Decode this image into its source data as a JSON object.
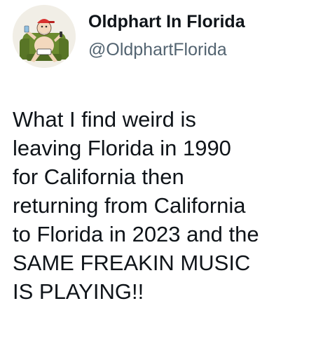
{
  "author": {
    "display_name": "Oldphart In Florida",
    "handle": "@OldphartFlorida",
    "avatar_icon": "cartoon-old-man-avatar-icon"
  },
  "tweet": {
    "lines": [
      "What I find weird is",
      "leaving Florida in 1990",
      "for California then",
      "returning from California",
      "to Florida in 2023 and the",
      "SAME FREAKIN MUSIC",
      "IS PLAYING!!"
    ]
  },
  "colors": {
    "text_primary": "#0f1419",
    "text_secondary": "#536471",
    "background": "#ffffff"
  }
}
